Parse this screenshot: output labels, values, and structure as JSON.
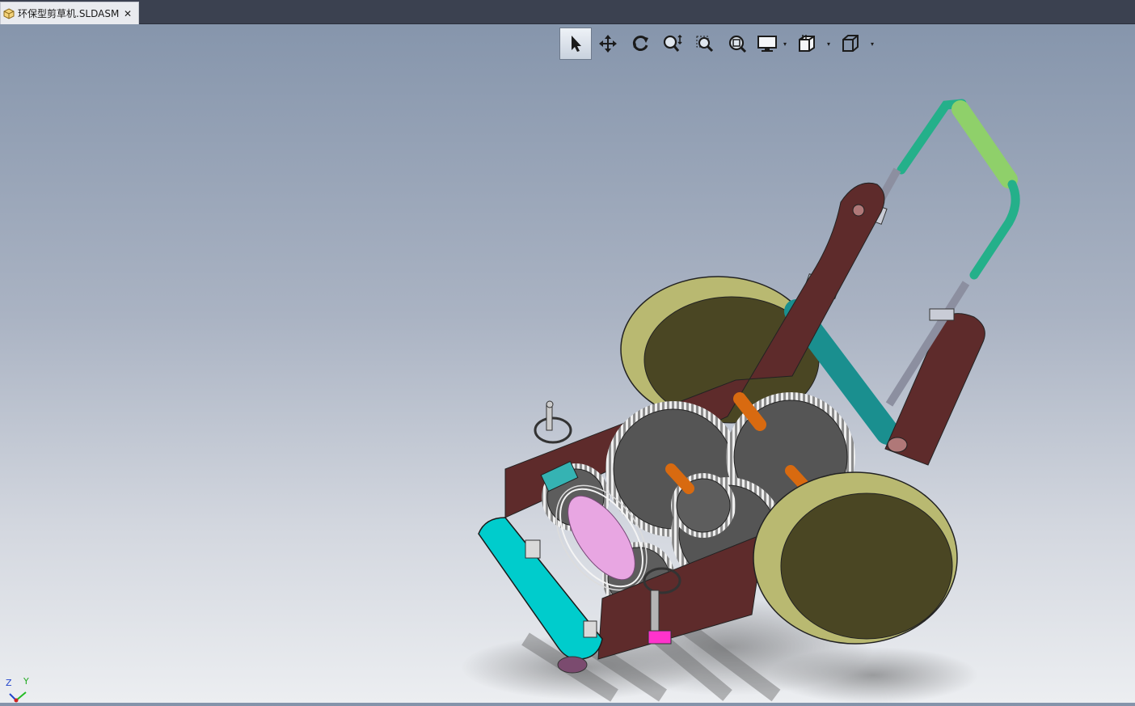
{
  "tab": {
    "title": "环保型剪草机.SLDASM",
    "close_glyph": "✕",
    "icon": "assembly-icon"
  },
  "heads_up_toolbar": {
    "buttons": [
      {
        "name": "select-icon",
        "active": true
      },
      {
        "name": "pan-icon",
        "active": false
      },
      {
        "name": "rotate-icon",
        "active": false
      },
      {
        "name": "zoom-in-out-icon",
        "active": false
      },
      {
        "name": "zoom-to-area-icon",
        "active": false
      },
      {
        "name": "zoom-to-fit-icon",
        "active": false
      },
      {
        "name": "display-style-icon",
        "active": false,
        "dropdown": true
      },
      {
        "name": "hide-show-items-icon",
        "active": false,
        "dropdown": true
      },
      {
        "name": "view-orientation-icon",
        "active": false,
        "dropdown": true
      }
    ],
    "caret_glyph": "▾"
  },
  "triad": {
    "z_label": "Z",
    "y_label": "Y"
  },
  "colors": {
    "frame": "#5e2b2b",
    "wheel": "#b9b971",
    "wheel_face": "#4a4623",
    "handle": "#24b08a",
    "cross_bar": "#1a8f8f",
    "blade_guard": "#00cccc",
    "shaft": "#d86a10",
    "gear": "#555555"
  }
}
